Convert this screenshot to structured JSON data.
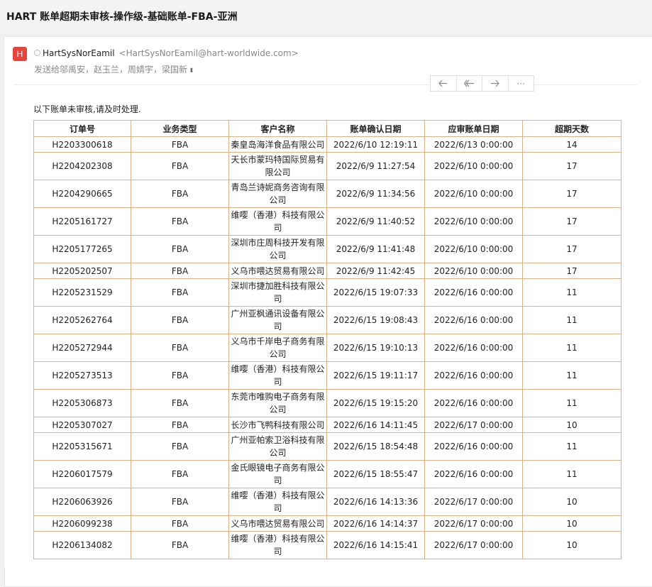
{
  "mail": {
    "subject": "HART 账单超期未审核-操作级-基础账单-FBA-亚洲",
    "avatar_letter": "H",
    "sender_name": "HartSysNorEamil",
    "sender_email": "<HartSysNorEamil@hart-worldwide.com>",
    "recipients": "发送给邬禹安，赵玉兰，周婧宇，梁国新",
    "body_text": "以下账单未审核,请及时处理."
  },
  "table": {
    "headers": [
      "订单号",
      "业务类型",
      "客户名称",
      "账单确认日期",
      "应审账单日期",
      "超期天数"
    ],
    "rows": [
      {
        "order": "H2203300618",
        "type": "FBA",
        "customer": "秦皇岛海洋食品有限公司",
        "confirm": "2022/6/10 12:19:11",
        "review": "2022/6/13 0:00:00",
        "days": "14"
      },
      {
        "order": "H2204202308",
        "type": "FBA",
        "customer": "天长市蒙玛特国际贸易有限公司",
        "confirm": "2022/6/9 11:27:54",
        "review": "2022/6/10 0:00:00",
        "days": "17"
      },
      {
        "order": "H2204290665",
        "type": "FBA",
        "customer": "青岛兰诗妮商务咨询有限公司",
        "confirm": "2022/6/9 11:34:56",
        "review": "2022/6/10 0:00:00",
        "days": "17"
      },
      {
        "order": "H2205161727",
        "type": "FBA",
        "customer": "维嘤（香港）科技有限公司",
        "confirm": "2022/6/9 11:40:52",
        "review": "2022/6/10 0:00:00",
        "days": "17"
      },
      {
        "order": "H2205177265",
        "type": "FBA",
        "customer": "深圳市庄周科技开发有限公司",
        "confirm": "2022/6/9 11:41:48",
        "review": "2022/6/10 0:00:00",
        "days": "17"
      },
      {
        "order": "H2205202507",
        "type": "FBA",
        "customer": "义乌市喂达贸易有限公司",
        "confirm": "2022/6/9 11:42:45",
        "review": "2022/6/10 0:00:00",
        "days": "17"
      },
      {
        "order": "H2205231529",
        "type": "FBA",
        "customer": "深圳市捷加胜科技有限公司",
        "confirm": "2022/6/15 19:07:33",
        "review": "2022/6/16 0:00:00",
        "days": "11"
      },
      {
        "order": "H2205262764",
        "type": "FBA",
        "customer": "广州亚枫通讯设备有限公司",
        "confirm": "2022/6/15 19:08:43",
        "review": "2022/6/16 0:00:00",
        "days": "11"
      },
      {
        "order": "H2205272944",
        "type": "FBA",
        "customer": "义乌市千岸电子商务有限公司",
        "confirm": "2022/6/15 19:10:13",
        "review": "2022/6/16 0:00:00",
        "days": "11"
      },
      {
        "order": "H2205273513",
        "type": "FBA",
        "customer": "维嘤（香港）科技有限公司",
        "confirm": "2022/6/15 19:11:17",
        "review": "2022/6/16 0:00:00",
        "days": "11"
      },
      {
        "order": "H2205306873",
        "type": "FBA",
        "customer": "东莞市唯购电子商务有限公司",
        "confirm": "2022/6/15 19:15:20",
        "review": "2022/6/16 0:00:00",
        "days": "11"
      },
      {
        "order": "H2205307027",
        "type": "FBA",
        "customer": "长沙市飞鸭科技有限公司",
        "confirm": "2022/6/16 14:11:45",
        "review": "2022/6/17 0:00:00",
        "days": "10"
      },
      {
        "order": "H2205315671",
        "type": "FBA",
        "customer": "广州亚帕索卫浴科技有限公司",
        "confirm": "2022/6/15 18:54:48",
        "review": "2022/6/16 0:00:00",
        "days": "11"
      },
      {
        "order": "H2206017579",
        "type": "FBA",
        "customer": "金氏眼镜电子商务有限公司",
        "confirm": "2022/6/15 18:55:47",
        "review": "2022/6/16 0:00:00",
        "days": "11"
      },
      {
        "order": "H2206063926",
        "type": "FBA",
        "customer": "维嘤（香港）科技有限公司",
        "confirm": "2022/6/16 14:13:36",
        "review": "2022/6/17 0:00:00",
        "days": "10"
      },
      {
        "order": "H2206099238",
        "type": "FBA",
        "customer": "义乌市喂达贸易有限公司",
        "confirm": "2022/6/16 14:14:37",
        "review": "2022/6/17 0:00:00",
        "days": "10"
      },
      {
        "order": "H2206134082",
        "type": "FBA",
        "customer": "维嘤（香港）科技有限公司",
        "confirm": "2022/6/16 14:15:41",
        "review": "2022/6/17 0:00:00",
        "days": "10"
      }
    ]
  },
  "actions": [
    {
      "name": "reply-icon",
      "glyph": "↶"
    },
    {
      "name": "reply-all-icon",
      "glyph": "↶"
    },
    {
      "name": "forward-icon",
      "glyph": "↷"
    },
    {
      "name": "more-icon",
      "glyph": "···"
    }
  ],
  "colors": {
    "avatar": "#e2463f",
    "table_border": "#d9b48a"
  }
}
